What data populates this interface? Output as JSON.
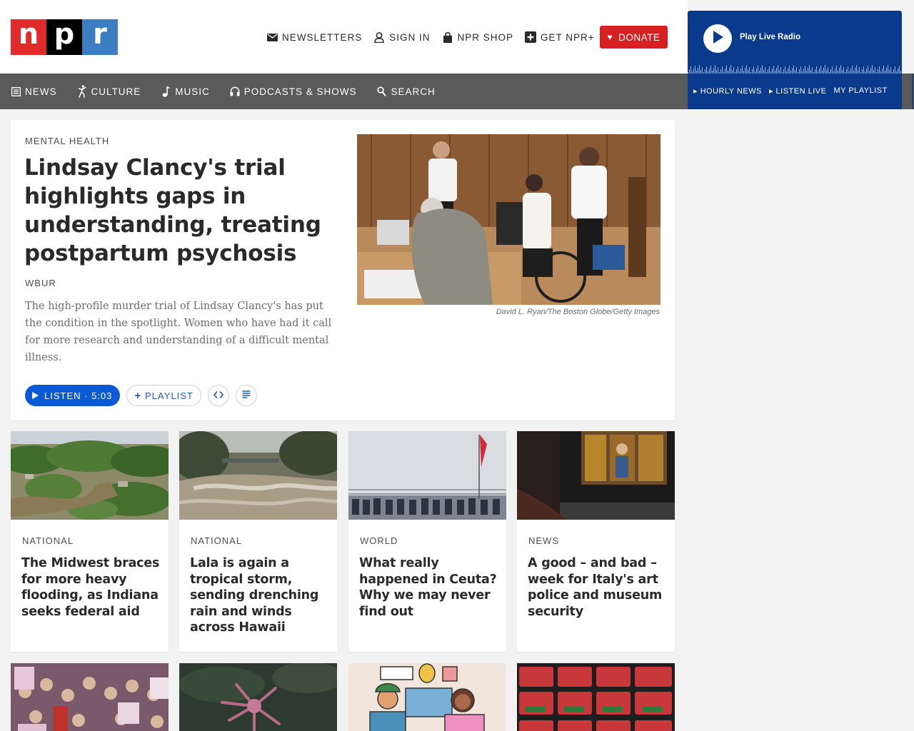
{
  "brand": {
    "letters": [
      "n",
      "p",
      "r"
    ],
    "colors": {
      "n": "#e12a2a",
      "p": "#000000",
      "r": "#3b7ec1"
    }
  },
  "utility": [
    {
      "label": "NEWSLETTERS",
      "icon": "envelope-icon"
    },
    {
      "label": "SIGN IN",
      "icon": "user-icon"
    },
    {
      "label": "NPR SHOP",
      "icon": "shopping-bag-icon"
    },
    {
      "label": "GET NPR+",
      "icon": "plus-square-icon"
    }
  ],
  "donate": {
    "label": "DONATE",
    "icon": "heart-icon",
    "color": "#d62021"
  },
  "nav": [
    {
      "label": "NEWS",
      "icon": "newspaper-icon"
    },
    {
      "label": "CULTURE",
      "icon": "dancer-icon"
    },
    {
      "label": "MUSIC",
      "icon": "music-note-icon"
    },
    {
      "label": "PODCASTS & SHOWS",
      "icon": "headphones-icon"
    },
    {
      "label": "SEARCH",
      "icon": "search-icon"
    }
  ],
  "player": {
    "label": "Play Live Radio",
    "links": [
      "▸ HOURLY NEWS",
      "▸ LISTEN LIVE",
      "MY PLAYLIST"
    ],
    "color": "#0a3a8c"
  },
  "featured": {
    "slug": "MENTAL HEALTH",
    "title": "Lindsay Clancy's trial highlights gaps in understanding, treating postpartum psychosis",
    "affiliation": "WBUR",
    "teaser": "The high-profile murder trial of Lindsay Clancy's has put the condition in the spotlight. Women who have had it call for more research and understanding of a difficult mental illness.",
    "credit": "David L. Ryan/The Boston Globe/Getty Images",
    "listen_label": "LISTEN · 5:03",
    "playlist_label": "PLAYLIST"
  },
  "cards": [
    {
      "slug": "NATIONAL",
      "title": "The Midwest braces for more heavy flooding, as Indiana seeks federal aid"
    },
    {
      "slug": "NATIONAL",
      "title": "Lala is again a tropical storm, sending drenching rain and winds across Hawaii"
    },
    {
      "slug": "WORLD",
      "title": "What really happened in Ceuta? Why we may never find out"
    },
    {
      "slug": "NEWS",
      "title": "A good – and bad – week for Italy's art police and museum security"
    }
  ],
  "accent": "#0a5ad6"
}
